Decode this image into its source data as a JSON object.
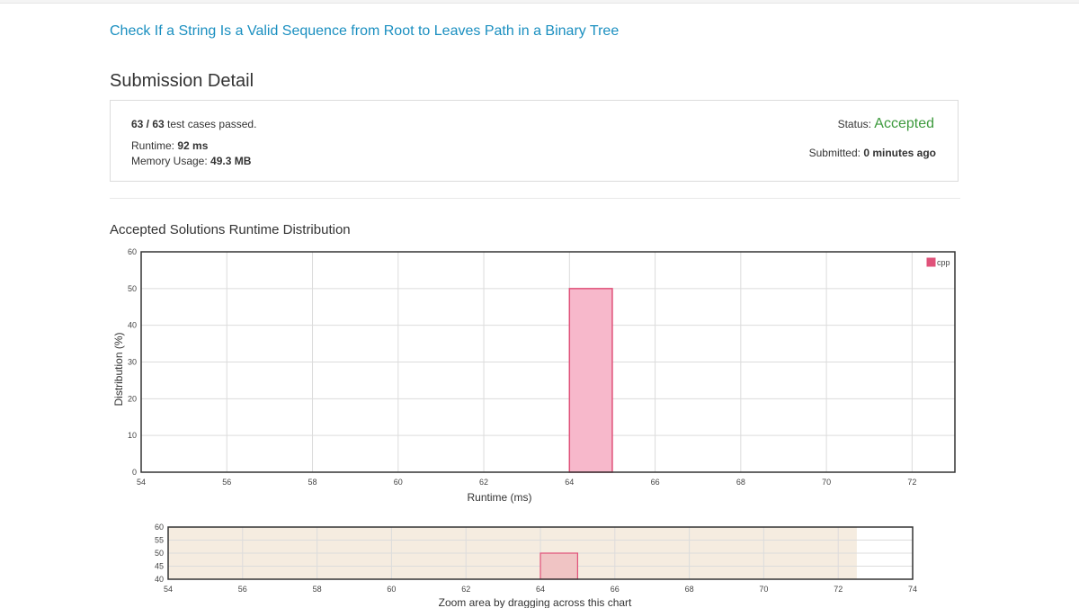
{
  "problem": {
    "title": "Check If a String Is a Valid Sequence from Root to Leaves Path in a Binary Tree"
  },
  "page": {
    "title": "Submission Detail"
  },
  "submission": {
    "passed": "63 / 63",
    "passed_suffix": " test cases passed.",
    "runtime_label": "Runtime: ",
    "runtime_value": "92 ms",
    "memory_label": "Memory Usage: ",
    "memory_value": "49.3 MB",
    "status_label": "Status: ",
    "status_value": "Accepted",
    "submitted_label": "Submitted: ",
    "submitted_value": "0 minutes ago"
  },
  "distribution": {
    "title": "Accepted Solutions Runtime Distribution"
  },
  "colors": {
    "accent_link": "#1a8fc0",
    "accepted": "#3d9a3d",
    "bar_fill": "#f7b8cb",
    "bar_stroke": "#e0527a",
    "zoom_area": "#f5ece0"
  },
  "chart_data": [
    {
      "type": "bar",
      "xlabel": "Runtime (ms)",
      "ylabel": "Distribution (%)",
      "xlim": [
        54,
        73
      ],
      "ylim": [
        0,
        60
      ],
      "x_ticks": [
        54,
        56,
        58,
        60,
        62,
        64,
        66,
        68,
        70,
        72
      ],
      "y_ticks": [
        0,
        10,
        20,
        30,
        40,
        50,
        60
      ],
      "grid": true,
      "legend": "top-right",
      "series": [
        {
          "name": "cpp",
          "bins": [
            {
              "x0": 64,
              "x1": 65,
              "value": 50
            }
          ]
        }
      ]
    },
    {
      "type": "bar",
      "title": "Zoom area by dragging across this chart",
      "xlim": [
        54,
        74
      ],
      "ylim": [
        40,
        60
      ],
      "x_ticks": [
        54,
        56,
        58,
        60,
        62,
        64,
        66,
        68,
        70,
        72,
        74
      ],
      "y_ticks": [
        40,
        45,
        50,
        55,
        60
      ],
      "grid": true,
      "selection": [
        54,
        72.5
      ],
      "series": [
        {
          "bins": [
            {
              "x0": 64,
              "x1": 65,
              "value": 50
            }
          ]
        }
      ]
    }
  ]
}
